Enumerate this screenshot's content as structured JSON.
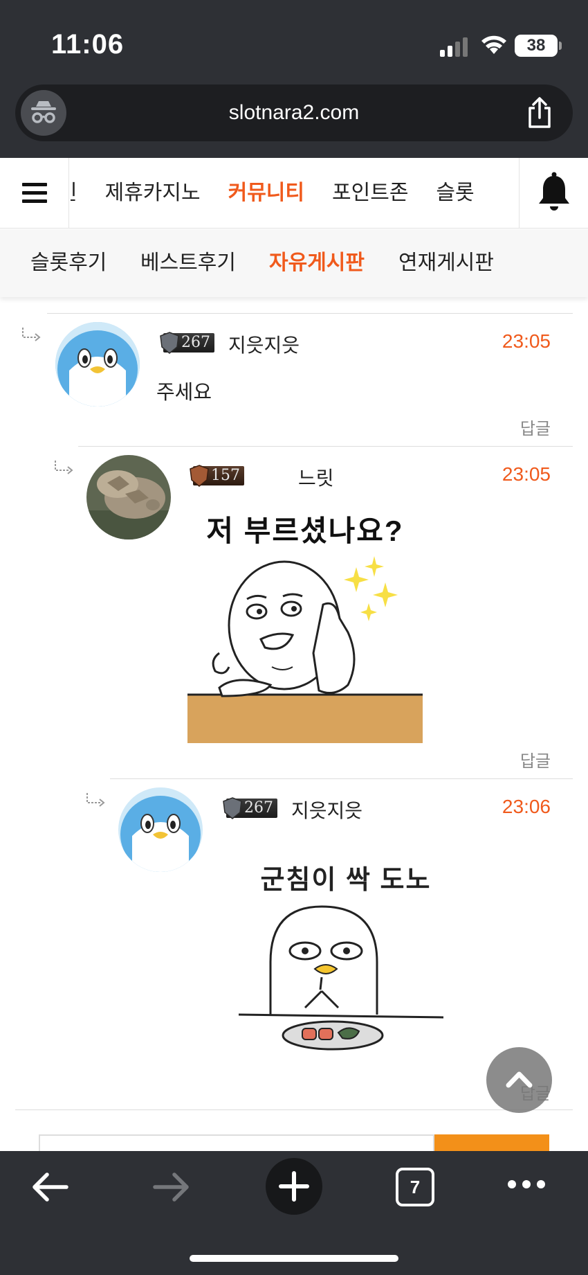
{
  "status_bar": {
    "time": "11:06",
    "battery": "38"
  },
  "browser": {
    "url": "slotnara2.com",
    "tab_count": "7"
  },
  "main_nav": {
    "items": [
      {
        "label": "인"
      },
      {
        "label": "제휴카지노"
      },
      {
        "label": "커뮤니티",
        "active": true
      },
      {
        "label": "포인트존"
      },
      {
        "label": "슬롯"
      }
    ]
  },
  "sub_nav": {
    "items": [
      {
        "label": "슬롯후기"
      },
      {
        "label": "베스트후기"
      },
      {
        "label": "자유게시판",
        "active": true
      },
      {
        "label": "연재게시판"
      }
    ]
  },
  "comments": [
    {
      "level": "267",
      "username": "지읏지읏",
      "time": "23:05",
      "text": "주세요",
      "reply_label": "답글"
    },
    {
      "level": "157",
      "username": "느릿",
      "time": "23:05",
      "image_caption": "저 부르셨나요?",
      "reply_label": "답글"
    },
    {
      "level": "267",
      "username": "지읏지읏",
      "time": "23:06",
      "image_caption": "군침이 싹 도노",
      "reply_label": "답글"
    }
  ],
  "colors": {
    "accent": "#f05a1c",
    "chrome": "#2e3035",
    "submit": "#f39019"
  },
  "icons": [
    "incognito-icon",
    "share-icon",
    "hamburger-icon",
    "bell-icon",
    "reply-arrow-icon",
    "back-icon",
    "forward-icon",
    "plus-icon",
    "tabs-icon",
    "more-icon",
    "chevron-up-icon"
  ]
}
